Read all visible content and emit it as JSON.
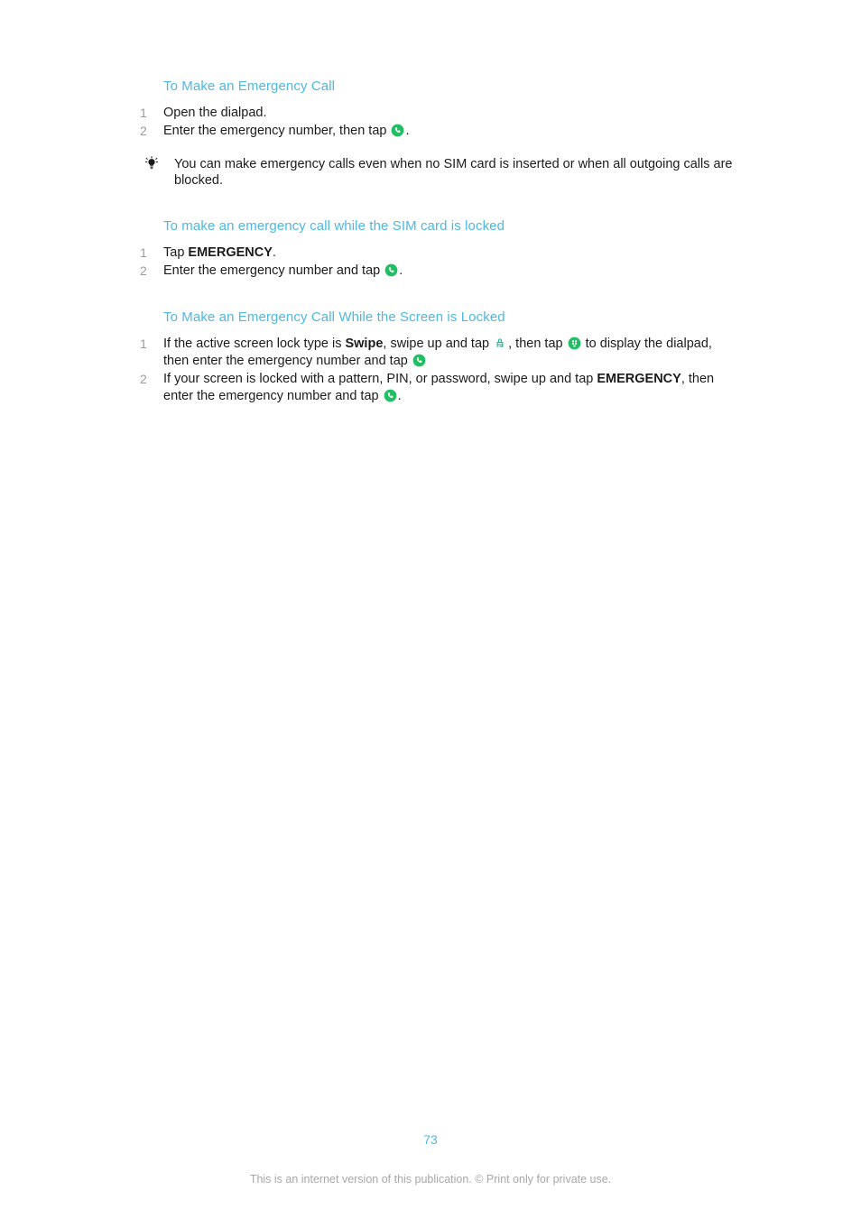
{
  "document": {
    "page_number": "73",
    "footer_note": "This is an internet version of this publication. © Print only for private use.",
    "accent_heading_color": "#4FB8E0",
    "step_number_color": "#9A9A9A",
    "body_text_color": "#1B1B1B",
    "icon_green": "#20BF63",
    "icon_teal": "#2BB7A3",
    "footer_text_color": "#A8A8A8"
  },
  "sections": [
    {
      "heading": "To Make an Emergency Call",
      "steps": [
        {
          "num": "1",
          "pre": "Open the dialpad.",
          "icon": null,
          "post": ""
        },
        {
          "num": "2",
          "pre": "Enter the emergency number, then tap ",
          "icon": "call-icon",
          "post": "."
        }
      ],
      "tip": {
        "icon": "lightbulb-tip-icon",
        "text": "You can make emergency calls even when no SIM card is inserted or when all outgoing calls are blocked."
      }
    },
    {
      "heading": "To make an emergency call while the SIM card is locked",
      "steps": [
        {
          "num": "1",
          "pre": "Tap ",
          "bold": "EMERGENCY",
          "post": "."
        },
        {
          "num": "2",
          "pre": "Enter the emergency number and tap ",
          "icon": "call-icon",
          "post": "."
        }
      ]
    },
    {
      "heading": "To Make an Emergency Call While the Screen is Locked",
      "steps": [
        {
          "num": "1",
          "part1": "If the active screen lock type is ",
          "bold1": "Swipe",
          "part2": ", swipe up and tap ",
          "icon1": "emergency-lock-icon",
          "part3": ", then tap ",
          "icon2": "dialpad-icon",
          "part4": " to display the dialpad, then enter the emergency number and tap ",
          "icon3": "call-icon",
          "part5": ""
        },
        {
          "num": "2",
          "part1": "If your screen is locked with a pattern, PIN, or password, swipe up and tap ",
          "bold1": "EMERGENCY",
          "part2": ", then enter the emergency number and tap ",
          "icon1": "call-icon",
          "part3": "."
        }
      ]
    }
  ]
}
